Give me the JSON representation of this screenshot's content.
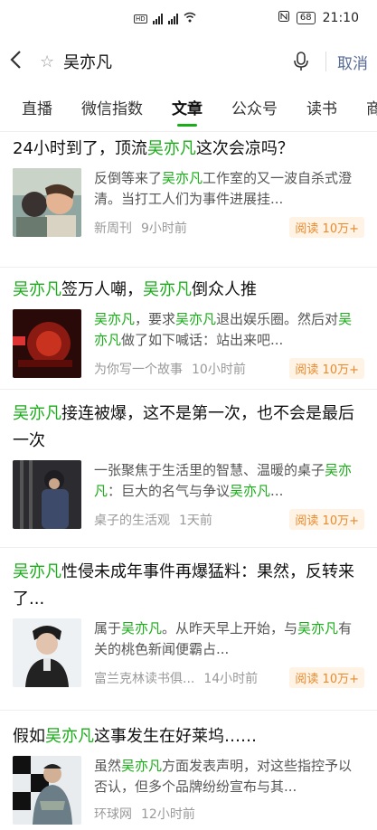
{
  "status_bar": {
    "time": "21:10",
    "battery": "68"
  },
  "search": {
    "query": "吴亦凡",
    "cancel_label": "取消"
  },
  "tabs": [
    {
      "label": "直播"
    },
    {
      "label": "微信指数"
    },
    {
      "label": "文章"
    },
    {
      "label": "公众号"
    },
    {
      "label": "读书"
    },
    {
      "label": "商"
    }
  ],
  "articles": [
    {
      "title": [
        "24小时到了，顶流",
        "吴亦凡",
        "这次会凉吗？"
      ],
      "desc": [
        "反倒等来了",
        "吴亦凡",
        "工作室的又一波自杀式澄清。当打工人们为事件进展挂..."
      ],
      "source": "新周刊",
      "time": "9小时前",
      "reads": "阅读 10万+"
    },
    {
      "title": [
        "",
        "吴亦凡",
        "签万人嘲，",
        "吴亦凡",
        "倒众人推"
      ],
      "desc": [
        "",
        "吴亦凡",
        "，要求",
        "吴亦凡",
        "退出娱乐圈。然后对",
        "吴亦凡",
        "做了如下喊话：站出来吧..."
      ],
      "source": "为你写一个故事",
      "time": "10小时前",
      "reads": "阅读 10万+"
    },
    {
      "title": [
        "",
        "吴亦凡",
        "接连被爆，这不是第一次，也不会是最后一次"
      ],
      "desc": [
        "一张聚焦于生活里的智慧、温暖的桌子",
        "吴亦凡",
        "：巨大的名气与争议",
        "吴亦凡",
        "..."
      ],
      "source": "桌子的生活观",
      "time": "1天前",
      "reads": "阅读 10万+"
    },
    {
      "title": [
        "",
        "吴亦凡",
        "性侵未成年事件再爆猛料：果然，反转来了..."
      ],
      "desc": [
        "属于",
        "吴亦凡",
        "。从昨天早上开始，与",
        "吴亦凡",
        "有关的桃色新闻便霸占..."
      ],
      "source": "富兰克林读书俱...",
      "time": "14小时前",
      "reads": "阅读 10万+"
    },
    {
      "title": [
        "假如",
        "吴亦凡",
        "这事发生在好莱坞……"
      ],
      "desc": [
        "虽然",
        "吴亦凡",
        "方面发表声明，对这些指控予以否认，但多个品牌纷纷宣布与其..."
      ],
      "source": "环球网",
      "time": "12小时前",
      "reads": ""
    }
  ]
}
